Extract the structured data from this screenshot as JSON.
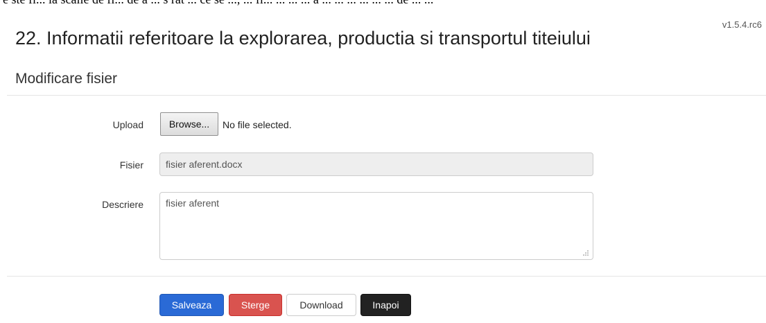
{
  "header": {
    "cut_text": "e ste fi... la scaile de fi... de a ... s rat ... ce se ..., ... fi... ... ... ... a ... ... ... ... ... ... de ... ..."
  },
  "version": "v1.5.4.rc6",
  "page_title": "22. Informatii referitoare la explorarea, productia si transportul titeiului",
  "section_title": "Modificare fisier",
  "form": {
    "upload": {
      "label": "Upload",
      "browse_label": "Browse...",
      "status": "No file selected."
    },
    "fisier": {
      "label": "Fisier",
      "value": "fisier aferent.docx"
    },
    "descriere": {
      "label": "Descriere",
      "value": "fisier aferent"
    }
  },
  "buttons": {
    "save": "Salveaza",
    "delete": "Sterge",
    "download": "Download",
    "back": "Inapoi"
  },
  "colors": {
    "save": "#2a6ad6",
    "delete": "#d9534f",
    "back": "#222222"
  }
}
